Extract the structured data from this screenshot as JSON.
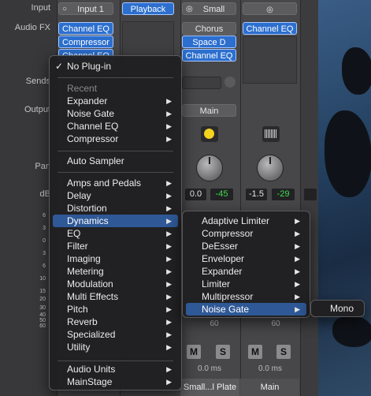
{
  "row_labels": {
    "input": "Input",
    "audio_fx": "Audio FX",
    "sends": "Sends",
    "output": "Output",
    "pan": "Pan",
    "db": "dB"
  },
  "scale": [
    "6",
    "3",
    "0",
    "3",
    "6",
    "10",
    "15",
    "20",
    "30",
    "40",
    "50",
    "60"
  ],
  "channels": [
    {
      "input": "Input 1",
      "fx": [
        "Channel EQ",
        "Compressor",
        "Channel EQ"
      ],
      "name": ""
    },
    {
      "input": "Playback",
      "fx": [],
      "name": "Small...l Plate",
      "pan_values": [],
      "delay": "0.0 ms"
    },
    {
      "input": "Small",
      "fx": [
        "Chorus",
        "Space D",
        "Channel EQ"
      ],
      "output": "Main",
      "pan_values": [
        "0.0",
        "-45"
      ],
      "delay": "0.0 ms",
      "name": "Small...l Plate"
    },
    {
      "input": "",
      "fx": [
        "Channel EQ"
      ],
      "pan_values": [
        "-1.5",
        "-29"
      ],
      "delay": "0.0 ms",
      "name": "Main"
    }
  ],
  "buttons": {
    "mute": "M",
    "solo": "S",
    "fader_mark": "60"
  },
  "menu_main": {
    "checked_item": "No Plug-in",
    "check_mark": "✓",
    "recent_header": "Recent",
    "recent": [
      "Expander",
      "Noise Gate",
      "Channel EQ",
      "Compressor"
    ],
    "auto_sampler": "Auto Sampler",
    "categories": [
      "Amps and Pedals",
      "Delay",
      "Distortion",
      "Dynamics",
      "EQ",
      "Filter",
      "Imaging",
      "Metering",
      "Modulation",
      "Multi Effects",
      "Pitch",
      "Reverb",
      "Specialized",
      "Utility"
    ],
    "highlighted": "Dynamics",
    "extra": [
      "Audio Units",
      "MainStage"
    ]
  },
  "menu_dynamics": {
    "items": [
      "Adaptive Limiter",
      "Compressor",
      "DeEsser",
      "Enveloper",
      "Expander",
      "Limiter",
      "Multipressor",
      "Noise Gate"
    ],
    "highlighted": "Noise Gate"
  },
  "menu_noisegate": {
    "items": [
      "Mono"
    ]
  },
  "arrow_glyph": "▶",
  "colors": {
    "highlight": "#2f5896",
    "slot_blue": "#2c6fcf",
    "link_green": "#3ddc4a"
  }
}
